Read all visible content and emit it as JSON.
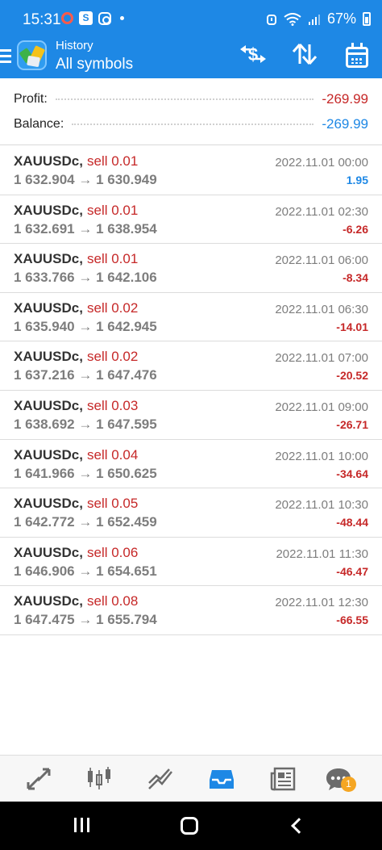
{
  "status_bar": {
    "time": "15:31",
    "notif_s": "S",
    "battery": "67%"
  },
  "app_bar": {
    "subtitle": "History",
    "title": "All symbols",
    "exchange_glyph": "$"
  },
  "summary": {
    "profit_label": "Profit:",
    "profit_value": "-269.99",
    "balance_label": "Balance:",
    "balance_value": "-269.99"
  },
  "colors": {
    "accent": "#1e88e5",
    "loss": "#c62828",
    "gain": "#1e88e5",
    "muted": "#7d7d7d"
  },
  "deals": [
    {
      "symbol": "XAUUSDc,",
      "side": "sell 0.01",
      "prices": "1 632.904 → 1 630.949",
      "datetime": "2022.11.01 00:00",
      "pl": "1.95",
      "positive": true
    },
    {
      "symbol": "XAUUSDc,",
      "side": "sell 0.01",
      "prices": "1 632.691 → 1 638.954",
      "datetime": "2022.11.01 02:30",
      "pl": "-6.26",
      "positive": false
    },
    {
      "symbol": "XAUUSDc,",
      "side": "sell 0.01",
      "prices": "1 633.766 → 1 642.106",
      "datetime": "2022.11.01 06:00",
      "pl": "-8.34",
      "positive": false
    },
    {
      "symbol": "XAUUSDc,",
      "side": "sell 0.02",
      "prices": "1 635.940 → 1 642.945",
      "datetime": "2022.11.01 06:30",
      "pl": "-14.01",
      "positive": false
    },
    {
      "symbol": "XAUUSDc,",
      "side": "sell 0.02",
      "prices": "1 637.216 → 1 647.476",
      "datetime": "2022.11.01 07:00",
      "pl": "-20.52",
      "positive": false
    },
    {
      "symbol": "XAUUSDc,",
      "side": "sell 0.03",
      "prices": "1 638.692 → 1 647.595",
      "datetime": "2022.11.01 09:00",
      "pl": "-26.71",
      "positive": false
    },
    {
      "symbol": "XAUUSDc,",
      "side": "sell 0.04",
      "prices": "1 641.966 → 1 650.625",
      "datetime": "2022.11.01 10:00",
      "pl": "-34.64",
      "positive": false
    },
    {
      "symbol": "XAUUSDc,",
      "side": "sell 0.05",
      "prices": "1 642.772 → 1 652.459",
      "datetime": "2022.11.01 10:30",
      "pl": "-48.44",
      "positive": false
    },
    {
      "symbol": "XAUUSDc,",
      "side": "sell 0.06",
      "prices": "1 646.906 → 1 654.651",
      "datetime": "2022.11.01 11:30",
      "pl": "-46.47",
      "positive": false
    },
    {
      "symbol": "XAUUSDc,",
      "side": "sell 0.08",
      "prices": "1 647.475 → 1 655.794",
      "datetime": "2022.11.01 12:30",
      "pl": "-66.55",
      "positive": false
    }
  ],
  "bottom_nav": {
    "items": [
      {
        "icon": "quotes-arrows-icon"
      },
      {
        "icon": "candlestick-chart-icon"
      },
      {
        "icon": "trade-chart-icon"
      },
      {
        "icon": "history-inbox-icon",
        "active": true
      },
      {
        "icon": "news-icon"
      },
      {
        "icon": "chat-icon",
        "badge": "1"
      }
    ]
  },
  "system_nav": {
    "icons": [
      "recent-apps-icon",
      "home-icon",
      "back-icon"
    ]
  }
}
